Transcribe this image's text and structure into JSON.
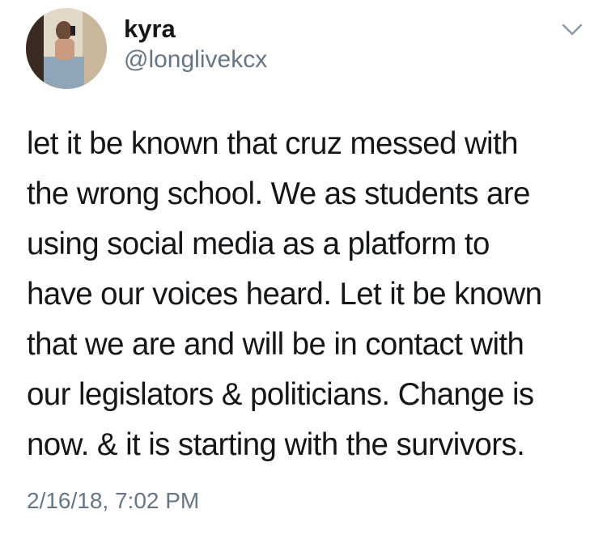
{
  "author": {
    "display_name": "kyra",
    "handle": "@longlivekcx",
    "avatar_icon": "profile-photo-avatar"
  },
  "menu": {
    "icon": "chevron-down-icon"
  },
  "tweet": {
    "lines": [
      "let it be known that cruz messed with",
      "the wrong school. We as students are",
      "using social media as a platform to",
      "have our voices heard. Let it be known",
      "that we are and will be in contact with",
      "our legislators & politicians. Change is",
      "now. & it is starting with the survivors."
    ],
    "timestamp": "2/16/18, 7:02 PM"
  },
  "colors": {
    "text_primary": "#14171a",
    "text_secondary": "#657786",
    "background": "#ffffff"
  }
}
